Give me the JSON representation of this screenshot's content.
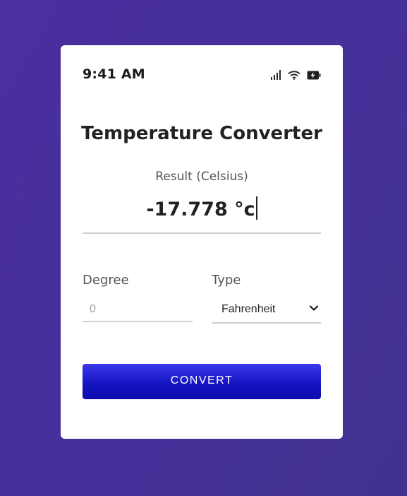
{
  "colors": {
    "background": "#4a2f9e",
    "card": "#ffffff",
    "button_gradient_top": "#3a3aec",
    "button_gradient_bottom": "#0c0cae",
    "divider": "#cfcfcf"
  },
  "status_bar": {
    "time": "9:41 AM",
    "icons": [
      "signal-icon",
      "wifi-icon",
      "battery-charging-icon"
    ]
  },
  "converter": {
    "title": "Temperature Converter",
    "result_label": "Result (Celsius)",
    "result_value": "-17.778 °c",
    "degree": {
      "label": "Degree",
      "value": "",
      "placeholder": "0"
    },
    "type": {
      "label": "Type",
      "selected": "Fahrenheit"
    },
    "convert_button_label": "CONVERT"
  }
}
